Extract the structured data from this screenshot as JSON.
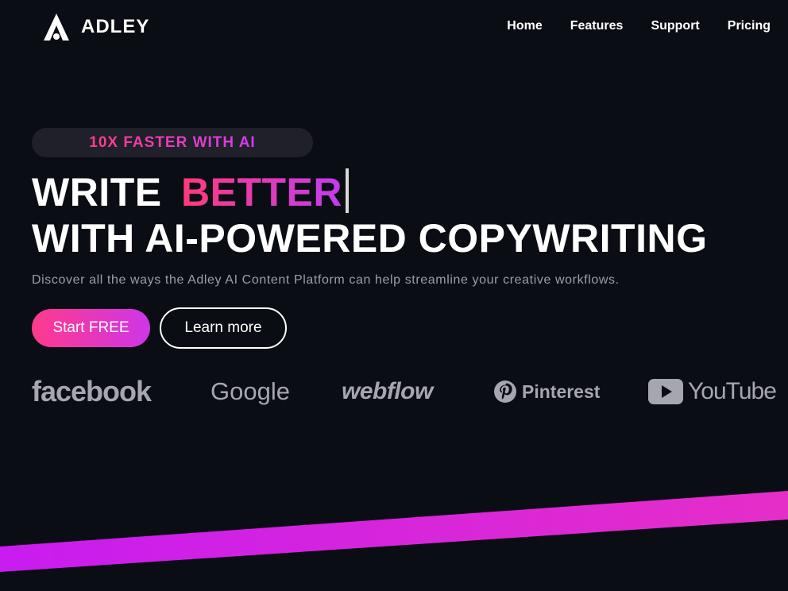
{
  "brand": {
    "name": "ADLEY",
    "logo_icon": "adley-logo-icon"
  },
  "nav": {
    "items": [
      {
        "label": "Home"
      },
      {
        "label": "Features"
      },
      {
        "label": "Support"
      },
      {
        "label": "Pricing"
      }
    ]
  },
  "hero": {
    "badge": "10X FASTER WITH AI",
    "headline_prefix": "WRITE",
    "headline_accent": "BETTER",
    "headline_line2": "WITH AI-POWERED COPYWRITING",
    "subtext": "Discover all the ways the Adley AI Content Platform can help streamline your creative workflows.",
    "primary_cta": "Start FREE",
    "secondary_cta": "Learn more"
  },
  "partners": [
    {
      "name": "facebook"
    },
    {
      "name": "Google"
    },
    {
      "name": "webflow"
    },
    {
      "name": "Pinterest",
      "icon": "pinterest-icon"
    },
    {
      "name": "YouTube",
      "icon": "youtube-play-icon"
    }
  ],
  "colors": {
    "background": "#0b0d14",
    "accent_pink": "#ff3a8c",
    "accent_purple": "#cf35e8",
    "muted_text": "#9b9ea8",
    "partner_logo": "#a5a6b0"
  }
}
